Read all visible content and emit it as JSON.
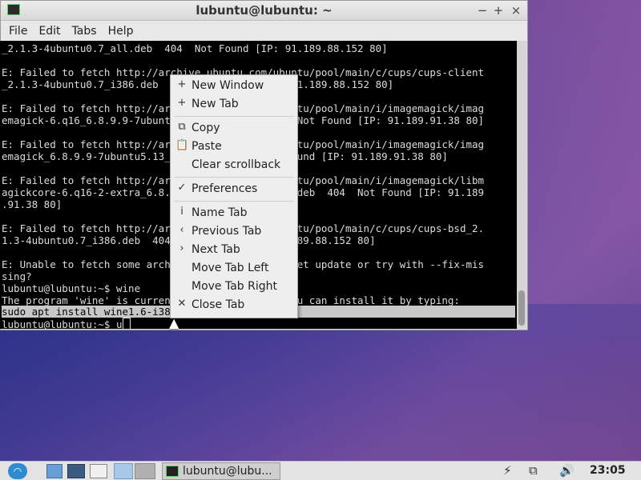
{
  "window": {
    "title": "lubuntu@lubuntu: ~",
    "controls": {
      "minimize": "−",
      "maximize": "+",
      "close": "×"
    }
  },
  "menubar": {
    "items": [
      "File",
      "Edit",
      "Tabs",
      "Help"
    ]
  },
  "terminal": {
    "lines": [
      "_2.1.3-4ubuntu0.7_all.deb  404  Not Found [IP: 91.189.88.152 80]",
      "",
      "E: Failed to fetch http://archive.ubuntu.com/ubuntu/pool/main/c/cups/cups-client",
      "_2.1.3-4ubuntu0.7_i386.deb  404  Not Found [IP: 91.189.88.152 80]",
      "",
      "E: Failed to fetch http://archive.ubuntu.com/ubuntu/pool/main/i/imagemagick/imag",
      "emagick-6.q16_6.8.9.9-7ubuntu5.13_i386.deb  404  Not Found [IP: 91.189.91.38 80]",
      "",
      "E: Failed to fetch http://archive.ubuntu.com/ubuntu/pool/main/i/imagemagick/imag",
      "emagick_6.8.9.9-7ubuntu5.13_i386.deb  404  Not Found [IP: 91.189.91.38 80]",
      "",
      "E: Failed to fetch http://archive.ubuntu.com/ubuntu/pool/main/i/imagemagick/libm",
      "agickcore-6.q16-2-extra_6.8.9.9-7ubuntu5.13_i386.deb  404  Not Found [IP: 91.189",
      ".91.38 80]",
      "",
      "E: Failed to fetch http://archive.ubuntu.com/ubuntu/pool/main/c/cups/cups-bsd_2.",
      "1.3-4ubuntu0.7_i386.deb  404  Not Found [IP: 91.189.88.152 80]",
      "",
      "E: Unable to fetch some archives, maybe run apt-get update or try with --fix-mis",
      "sing?",
      "lubuntu@lubuntu:~$ wine",
      "The program 'wine' is currently not installed. You can install it by typing:",
      "sudo apt install wine1.6-i386"
    ],
    "prompt": "lubuntu@lubuntu:~$ ",
    "input": "u"
  },
  "context_menu": {
    "items": [
      {
        "label": "New Window",
        "icon": "+"
      },
      {
        "label": "New Tab",
        "icon": "+"
      },
      {
        "label": "Copy",
        "icon": "⧉"
      },
      {
        "label": "Paste",
        "icon": "📋"
      },
      {
        "label": "Clear scrollback",
        "icon": ""
      },
      {
        "label": "Preferences",
        "icon": "✓"
      },
      {
        "label": "Name Tab",
        "icon": "i"
      },
      {
        "label": "Previous Tab",
        "icon": "‹"
      },
      {
        "label": "Next Tab",
        "icon": "›"
      },
      {
        "label": "Move Tab Left",
        "icon": ""
      },
      {
        "label": "Move Tab Right",
        "icon": ""
      },
      {
        "label": "Close Tab",
        "icon": "✕"
      }
    ]
  },
  "taskbar": {
    "task_label": "lubuntu@lubu...",
    "clock": "23:05",
    "tray": {
      "power": "⚡",
      "network": "⧉",
      "volume": "🔊"
    }
  }
}
